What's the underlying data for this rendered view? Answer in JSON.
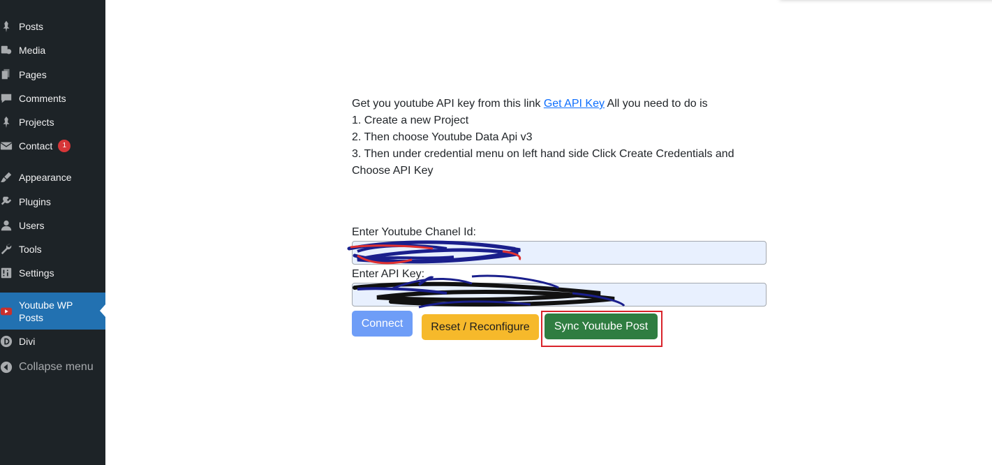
{
  "sidebar": {
    "items": [
      {
        "label": "Posts",
        "icon": "pin-icon"
      },
      {
        "label": "Media",
        "icon": "media-icon"
      },
      {
        "label": "Pages",
        "icon": "pages-icon"
      },
      {
        "label": "Comments",
        "icon": "comment-icon"
      },
      {
        "label": "Projects",
        "icon": "pin-icon"
      },
      {
        "label": "Contact",
        "icon": "mail-icon",
        "badge": "1"
      },
      {
        "label": "Appearance",
        "icon": "brush-icon"
      },
      {
        "label": "Plugins",
        "icon": "plugin-icon"
      },
      {
        "label": "Users",
        "icon": "user-icon"
      },
      {
        "label": "Tools",
        "icon": "wrench-icon"
      },
      {
        "label": "Settings",
        "icon": "settings-icon"
      },
      {
        "label": "Youtube WP Posts",
        "label_line1": "Youtube WP",
        "label_line2": "Posts",
        "icon": "youtube-icon",
        "active": true
      },
      {
        "label": "Divi",
        "icon": "divi-icon"
      },
      {
        "label": "Collapse menu",
        "icon": "collapse-icon"
      }
    ]
  },
  "instructions": {
    "intro": "Get you youtube API key from this link",
    "link_text": "Get API Key",
    "intro_after": "All you need to do is",
    "step1": "1. Create a new Project",
    "step2": "2. Then choose Youtube Data Api v3",
    "step3": "3. Then under credential menu on left hand side Click Create Credentials and Choose API Key"
  },
  "form": {
    "channel_label": "Enter Youtube Chanel Id:",
    "api_label": "Enter API Key:"
  },
  "buttons": {
    "connect": "Connect",
    "reset": "Reset / Reconfigure",
    "sync": "Sync Youtube Post"
  },
  "colors": {
    "sidebar_bg": "#1d2327",
    "active_bg": "#2271b1",
    "connect_bg": "#6e9df7",
    "reset_bg": "#f6b92b",
    "sync_bg": "#2f7d41",
    "highlight": "#d9232a"
  }
}
